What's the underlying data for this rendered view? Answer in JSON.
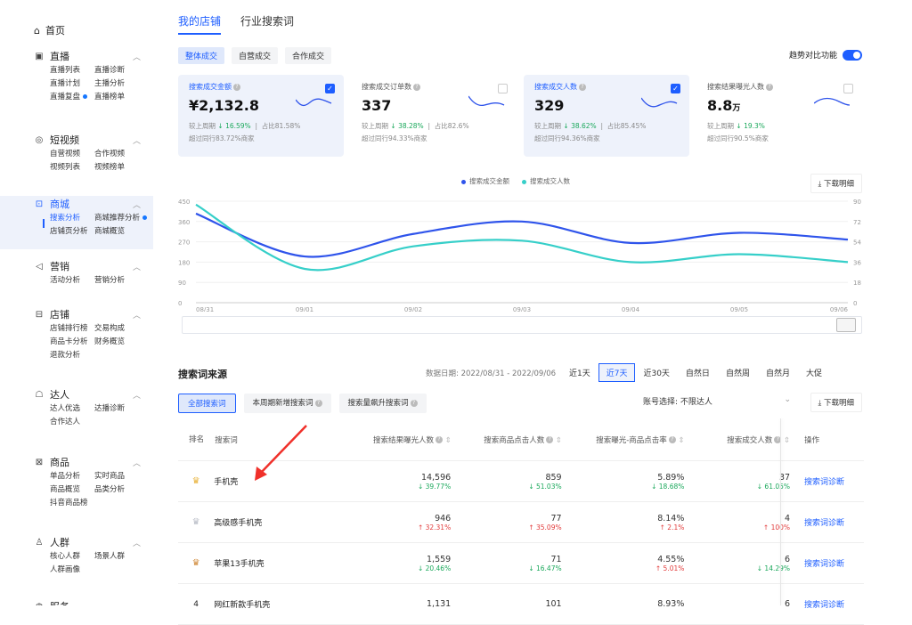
{
  "sidebar": {
    "home": "首页",
    "sections": [
      {
        "label": "直播",
        "icon": "live-icon",
        "items": [
          "直播列表",
          "直播诊断",
          "直播计划",
          "主播分析",
          "直播复盘",
          "直播榜单"
        ],
        "dot_index": 4
      },
      {
        "label": "短视频",
        "icon": "video-icon",
        "items": [
          "自营视频",
          "合作视频",
          "视频列表",
          "视频榜单"
        ]
      },
      {
        "label": "商城",
        "icon": "mall-icon",
        "items": [
          "搜索分析",
          "商城推荐分析",
          "店铺页分析",
          "商城概览"
        ],
        "selected_index": 0,
        "dot_index": 1,
        "active": true
      },
      {
        "label": "营销",
        "icon": "marketing-icon",
        "items": [
          "活动分析",
          "营销分析"
        ]
      },
      {
        "label": "店铺",
        "icon": "shop-icon",
        "items": [
          "店铺排行榜",
          "交易构成",
          "商品卡分析",
          "财务概览",
          "退款分析"
        ]
      },
      {
        "label": "达人",
        "icon": "talent-icon",
        "items": [
          "达人优选",
          "达播诊断",
          "合作达人"
        ]
      },
      {
        "label": "商品",
        "icon": "product-icon",
        "items": [
          "单品分析",
          "实时商品",
          "商品概览",
          "品类分析",
          "抖音商品榜"
        ]
      },
      {
        "label": "人群",
        "icon": "crowd-icon",
        "items": [
          "核心人群",
          "场景人群",
          "人群画像"
        ]
      },
      {
        "label": "服务",
        "icon": "service-icon",
        "items": []
      }
    ]
  },
  "main": {
    "tabs": [
      "我的店铺",
      "行业搜索词"
    ],
    "mode_buttons": [
      "整体成交",
      "自营成交",
      "合作成交"
    ],
    "trend_label": "趋势对比功能",
    "cards": [
      {
        "title": "搜索成交金额",
        "value": "¥2,132.8",
        "unit": "",
        "compare": "较上周期",
        "change": "16.59%",
        "share": "占比81.58%",
        "peer": "超过同行83.72%商家",
        "checked": true
      },
      {
        "title": "搜索成交订单数",
        "value": "337",
        "unit": "",
        "compare": "较上周期",
        "change": "38.28%",
        "share": "占比82.6%",
        "peer": "超过同行94.33%商家",
        "checked": false
      },
      {
        "title": "搜索成交人数",
        "value": "329",
        "unit": "",
        "compare": "较上周期",
        "change": "38.62%",
        "share": "占比85.45%",
        "peer": "超过同行94.36%商家",
        "checked": true
      },
      {
        "title": "搜索结果曝光人数",
        "value": "8.8",
        "unit": "万",
        "compare": "较上周期",
        "change": "19.3%",
        "share": "",
        "peer": "超过同行90.5%商家",
        "checked": false
      }
    ],
    "download_label": "下载明细",
    "source_title": "搜索词来源",
    "date_range": "数据日期: 2022/08/31 - 2022/09/06",
    "periods": [
      "近1天",
      "近7天",
      "近30天",
      "自然日",
      "自然周",
      "自然月",
      "大促"
    ],
    "kw_tabs": [
      "全部搜索词",
      "本周期新增搜索词",
      "搜索量飙升搜索词"
    ],
    "account_label": "账号选择: 不限达人",
    "table": {
      "headers": [
        "排名",
        "搜索词",
        "搜索结果曝光人数",
        "搜索商品点击人数",
        "搜索曝光-商品点击率",
        "搜索成交人数",
        "操作"
      ],
      "rows": [
        {
          "rank": "",
          "keyword": "手机壳",
          "exposure": "14,596",
          "exposure_chg": "↓ 39.77%",
          "clicks": "859",
          "clicks_chg": "↓ 51.03%",
          "ctr": "5.89%",
          "ctr_chg": "↓ 18.68%",
          "deals": "37",
          "deals_chg": "↓ 61.05%",
          "action": "搜索词诊断",
          "dirs": [
            "d",
            "d",
            "d",
            "d"
          ]
        },
        {
          "rank": "",
          "keyword": "高级感手机壳",
          "exposure": "946",
          "exposure_chg": "↑ 32.31%",
          "clicks": "77",
          "clicks_chg": "↑ 35.09%",
          "ctr": "8.14%",
          "ctr_chg": "↑ 2.1%",
          "deals": "4",
          "deals_chg": "↑ 100%",
          "action": "搜索词诊断",
          "dirs": [
            "u",
            "u",
            "u",
            "u"
          ]
        },
        {
          "rank": "",
          "keyword": "苹果13手机壳",
          "exposure": "1,559",
          "exposure_chg": "↓ 20.46%",
          "clicks": "71",
          "clicks_chg": "↓ 16.47%",
          "ctr": "4.55%",
          "ctr_chg": "↑ 5.01%",
          "deals": "6",
          "deals_chg": "↓ 14.29%",
          "action": "搜索词诊断",
          "dirs": [
            "d",
            "d",
            "u",
            "d"
          ]
        },
        {
          "rank": "4",
          "keyword": "网红新款手机壳",
          "exposure": "1,131",
          "exposure_chg": "",
          "clicks": "101",
          "clicks_chg": "",
          "ctr": "8.93%",
          "ctr_chg": "",
          "deals": "6",
          "deals_chg": "",
          "action": "搜索词诊断",
          "dirs": [
            "d",
            "d",
            "d",
            "d"
          ]
        }
      ]
    }
  },
  "chart_data": {
    "type": "line",
    "categories": [
      "08/31",
      "09/01",
      "09/02",
      "09/03",
      "09/04",
      "09/05",
      "09/06"
    ],
    "series": [
      {
        "name": "搜索成交金额",
        "color": "#2f54eb",
        "axis": "left",
        "values": [
          395,
          205,
          305,
          360,
          265,
          310,
          280
        ]
      },
      {
        "name": "搜索成交人数",
        "color": "#36cfc9",
        "axis": "right",
        "values": [
          87,
          30,
          50,
          55,
          36,
          43,
          36
        ]
      }
    ],
    "ylim_left": [
      0,
      450
    ],
    "yticks_left": [
      "0",
      "90",
      "180",
      "270",
      "360",
      "450"
    ],
    "ylim_right": [
      0,
      90
    ],
    "yticks_right": [
      "0",
      "18",
      "36",
      "54",
      "72",
      "90"
    ],
    "grid": true,
    "legend": "top-center"
  }
}
